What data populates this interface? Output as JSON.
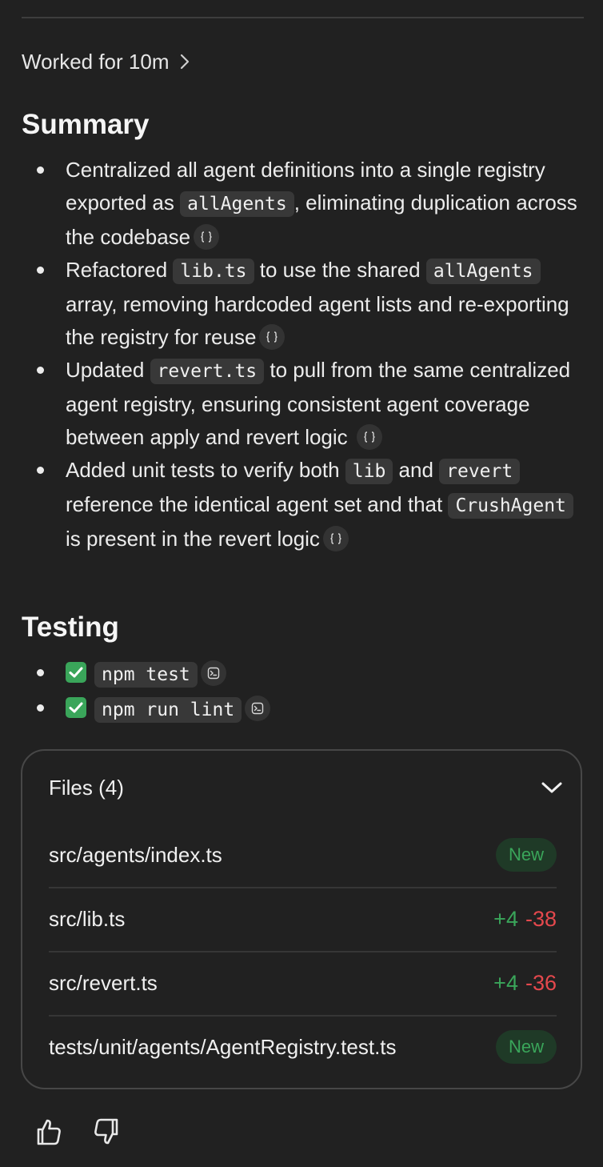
{
  "work": {
    "label": "Worked for 10m"
  },
  "summary": {
    "heading": "Summary",
    "items": [
      {
        "t1": "Centralized all agent definitions into a single registry exported as ",
        "c1": "allAgents",
        "t2": ", eliminating duplication across the codebase"
      },
      {
        "t1": "Refactored ",
        "c1": "lib.ts",
        "t2": " to use the shared ",
        "c2": "allAgents",
        "t3": " array, removing hardcoded agent lists and re-exporting the registry for reuse"
      },
      {
        "t1": "Updated ",
        "c1": "revert.ts",
        "t2": " to pull from the same centralized agent registry, ensuring consistent agent coverage between apply and revert logic"
      },
      {
        "t1": "Added unit tests to verify both ",
        "c1": "lib",
        "t2": " and ",
        "c2": "revert",
        "t3": " reference the identical agent set and that ",
        "c3": "CrushAgent",
        "t4": " is present in the revert logic"
      }
    ]
  },
  "testing": {
    "heading": "Testing",
    "items": [
      {
        "command": "npm test",
        "status": "passed"
      },
      {
        "command": "npm run lint",
        "status": "passed"
      }
    ]
  },
  "files": {
    "title": "Files (4)",
    "rows": [
      {
        "path": "src/agents/index.ts",
        "badge": "New"
      },
      {
        "path": "src/lib.ts",
        "added": "+4",
        "removed": "-38"
      },
      {
        "path": "src/revert.ts",
        "added": "+4",
        "removed": "-36"
      },
      {
        "path": "tests/unit/agents/AgentRegistry.test.ts",
        "badge": "New"
      }
    ]
  },
  "colors": {
    "background": "#212121",
    "code_bg": "#383838",
    "added": "#3aa55a",
    "removed": "#e5484d",
    "badge_bg": "#1f3a27"
  },
  "icons": {
    "work_chevron": "chevron-right-icon",
    "citation": "curly-braces-icon",
    "terminal": "terminal-icon",
    "check": "check-mark-button-icon",
    "collapse": "chevron-down-icon",
    "like": "thumbs-up-icon",
    "dislike": "thumbs-down-icon"
  }
}
